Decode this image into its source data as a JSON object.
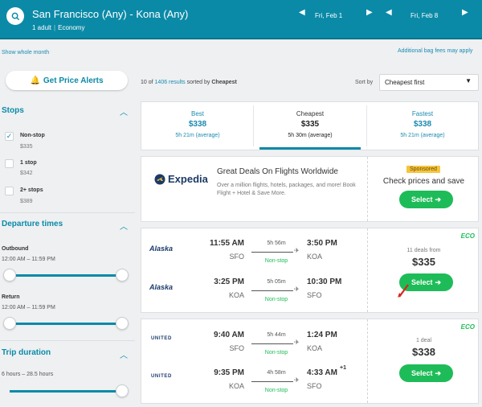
{
  "header": {
    "route": "San Francisco (Any) - Kona (Any)",
    "passengers": "1 adult",
    "cabin": "Economy",
    "depart_date": "Fri, Feb 1",
    "return_date": "Fri, Feb 8"
  },
  "links": {
    "show_whole_month": "Show whole month",
    "bag_fees": "Additional bag fees may apply"
  },
  "alerts": {
    "label": "Get Price Alerts"
  },
  "filters": {
    "stops": {
      "title": "Stops",
      "options": [
        {
          "label": "Non-stop",
          "price": "$335",
          "checked": true
        },
        {
          "label": "1 stop",
          "price": "$342",
          "checked": false
        },
        {
          "label": "2+ stops",
          "price": "$389",
          "checked": false
        }
      ]
    },
    "departure": {
      "title": "Departure times",
      "outbound_label": "Outbound",
      "outbound_range": "12:00 AM – 11:59 PM",
      "return_label": "Return",
      "return_range": "12:00 AM – 11:59 PM"
    },
    "duration": {
      "title": "Trip duration",
      "range": "6 hours – 28.5 hours"
    }
  },
  "results": {
    "prefix": "10 of",
    "count": "1406 results",
    "suffix": "sorted by",
    "sorted_by": "Cheapest",
    "sort_label": "Sort by",
    "sort_value": "Cheapest first"
  },
  "tabs": [
    {
      "title": "Best",
      "price": "$338",
      "duration": "5h 21m (average)"
    },
    {
      "title": "Cheapest",
      "price": "$335",
      "duration": "5h 30m (average)"
    },
    {
      "title": "Fastest",
      "price": "$338",
      "duration": "5h 21m (average)"
    }
  ],
  "ad": {
    "brand": "Expedia",
    "title": "Great Deals On Flights Worldwide",
    "desc": "Over a million flights, hotels, packages, and more! Book Flight + Hotel & Save More.",
    "sponsored": "Sponsored",
    "cta_text": "Check prices and save",
    "button": "Select"
  },
  "flights": [
    {
      "airline": "Alaska",
      "eco": "ECO",
      "deals": "11 deals from",
      "price": "$335",
      "button": "Select",
      "legs": [
        {
          "dep_time": "11:55 AM",
          "dep_airport": "SFO",
          "duration": "5h 56m",
          "stops": "Non-stop",
          "arr_time": "3:50 PM",
          "arr_airport": "KOA",
          "plus": ""
        },
        {
          "dep_time": "3:25 PM",
          "dep_airport": "KOA",
          "duration": "5h 05m",
          "stops": "Non-stop",
          "arr_time": "10:30 PM",
          "arr_airport": "SFO",
          "plus": ""
        }
      ]
    },
    {
      "airline": "UNITED",
      "eco": "ECO",
      "deals": "1 deal",
      "price": "$338",
      "button": "Select",
      "legs": [
        {
          "dep_time": "9:40 AM",
          "dep_airport": "SFO",
          "duration": "5h 44m",
          "stops": "Non-stop",
          "arr_time": "1:24 PM",
          "arr_airport": "KOA",
          "plus": ""
        },
        {
          "dep_time": "9:35 PM",
          "dep_airport": "KOA",
          "duration": "4h 58m",
          "stops": "Non-stop",
          "arr_time": "4:33 AM",
          "arr_airport": "SFO",
          "plus": "+1"
        }
      ]
    }
  ]
}
